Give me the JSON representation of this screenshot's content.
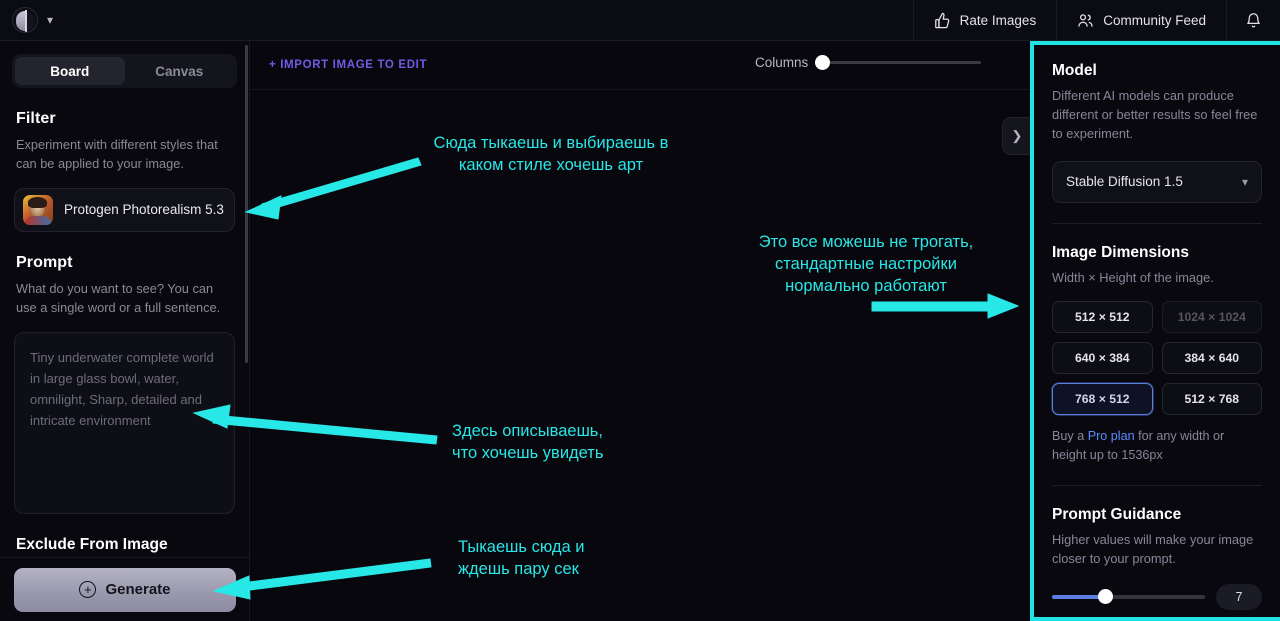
{
  "topbar": {
    "logo_name": "app-logo",
    "items": [
      {
        "label": "Rate Images",
        "icon": "thumbs-up-icon"
      },
      {
        "label": "Community Feed",
        "icon": "people-icon"
      },
      {
        "label": "",
        "icon": "bell-icon"
      }
    ]
  },
  "sidebar": {
    "tabs": [
      {
        "label": "Board",
        "active": true
      },
      {
        "label": "Canvas",
        "active": false
      }
    ],
    "filter": {
      "title": "Filter",
      "description": "Experiment with different styles that can be applied to your image.",
      "selected": "Protogen Photorealism 5.3"
    },
    "prompt": {
      "title": "Prompt",
      "description": "What do you want to see? You can use a single word or a full sentence.",
      "placeholder": "Tiny underwater complete world in large glass bowl, water, omnilight, Sharp, detailed and intricate environment",
      "value": ""
    },
    "exclude": {
      "title": "Exclude From Image"
    },
    "generate": {
      "label": "Generate",
      "icon": "plus-circle-icon"
    }
  },
  "center": {
    "import_link": "+ IMPORT IMAGE TO EDIT",
    "columns": {
      "label": "Columns",
      "value": 1
    },
    "expand_icon": "chevron-right-icon"
  },
  "right_panel": {
    "model": {
      "title": "Model",
      "description": "Different AI models can produce different or better results so feel free to experiment.",
      "selected": "Stable Diffusion 1.5",
      "chevron": "chevron-down-icon"
    },
    "dimensions": {
      "title": "Image Dimensions",
      "description": "Width × Height of the image.",
      "options": [
        {
          "label": "512 × 512",
          "state": "normal"
        },
        {
          "label": "1024 × 1024",
          "state": "disabled"
        },
        {
          "label": "640 × 384",
          "state": "normal"
        },
        {
          "label": "384 × 640",
          "state": "normal"
        },
        {
          "label": "768 × 512",
          "state": "selected"
        },
        {
          "label": "512 × 768",
          "state": "normal"
        }
      ],
      "note_before": "Buy a ",
      "note_link": "Pro plan",
      "note_after": " for any width or height up to 1536px"
    },
    "guidance": {
      "title": "Prompt Guidance",
      "description": "Higher values will make your image closer to your prompt.",
      "value": "7"
    }
  },
  "annotations": [
    {
      "id": "filter-annotation",
      "text": "Сюда тыкаешь и выбираешь в\nкаком стиле хочешь арт"
    },
    {
      "id": "settings-annotation",
      "text": "Это все можешь не трогать,\nстандартные настройки\nнормально работают"
    },
    {
      "id": "prompt-annotation",
      "text": "Здесь описываешь,\nчто хочешь увидеть"
    },
    {
      "id": "generate-annotation",
      "text": "Тыкаешь сюда и\nждешь пару сек"
    }
  ],
  "colors": {
    "annotation": "#28e7e7",
    "accent_purple": "#6f5ce6",
    "accent_blue": "#5b7fe0",
    "panel_border": "#22e3e3"
  }
}
